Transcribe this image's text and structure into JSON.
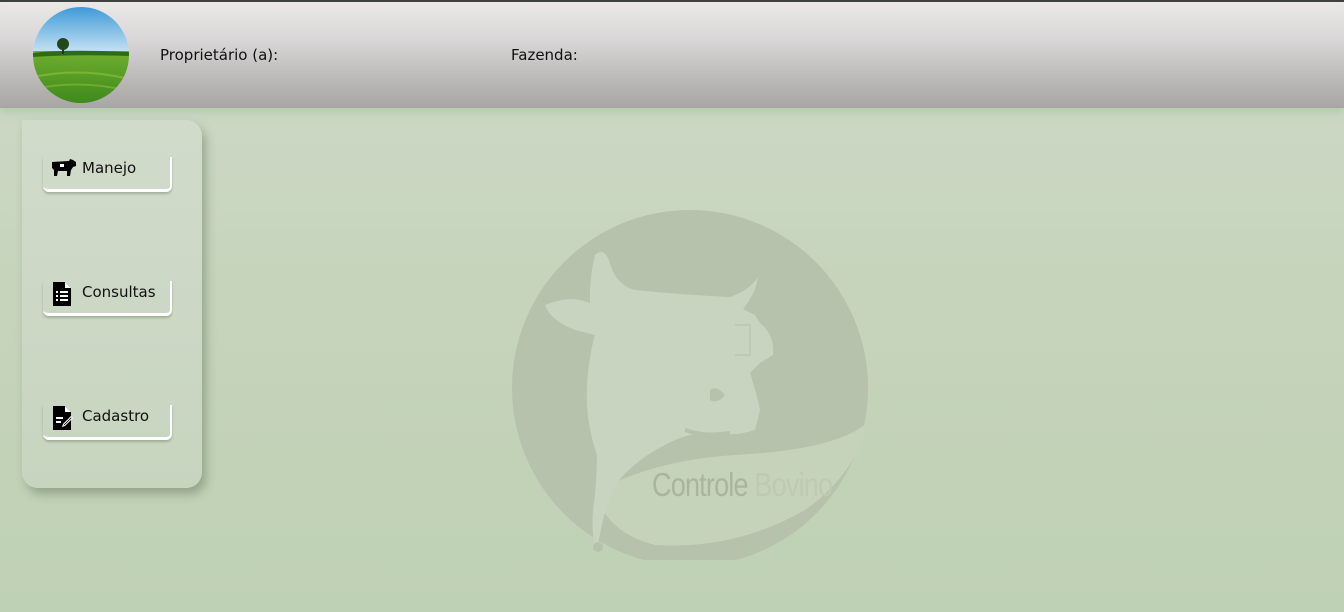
{
  "header": {
    "owner_label": "Proprietário (a):",
    "farm_label": "Fazenda:"
  },
  "sidebar": {
    "items": [
      {
        "label": "Manejo",
        "icon": "cow-icon"
      },
      {
        "label": "Consultas",
        "icon": "document-list-icon"
      },
      {
        "label": "Cadastro",
        "icon": "document-edit-icon"
      }
    ]
  },
  "watermark": {
    "word1": "Controle",
    "word2": "Bovino"
  },
  "colors": {
    "background": "#c6d4bc",
    "header": "#d0cece",
    "watermark": "#b4c0aa"
  }
}
